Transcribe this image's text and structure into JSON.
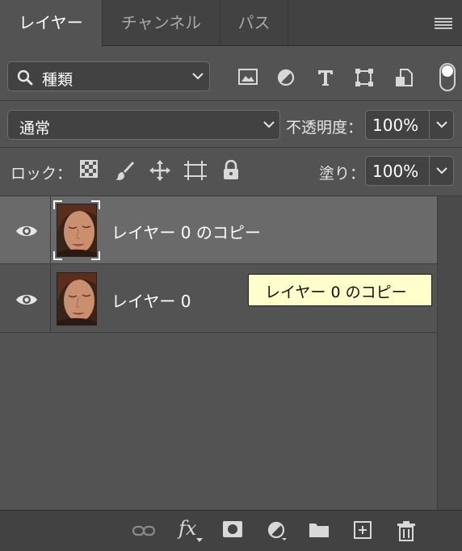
{
  "tabs": [
    {
      "label": "レイヤー",
      "active": true
    },
    {
      "label": "チャンネル",
      "active": false
    },
    {
      "label": "パス",
      "active": false
    }
  ],
  "filter": {
    "kind_label": "種類",
    "icons": [
      "image-filter-icon",
      "adjustment-filter-icon",
      "type-filter-icon",
      "shape-filter-icon",
      "smart-object-filter-icon"
    ],
    "toggle_on": true
  },
  "blend": {
    "mode": "通常",
    "opacity_label": "不透明度：",
    "opacity_value": "100%"
  },
  "lock": {
    "label": "ロック：",
    "icons": [
      "lock-transparent-pixels-icon",
      "lock-image-pixels-icon",
      "lock-position-icon",
      "lock-artboard-icon",
      "lock-all-icon"
    ],
    "fill_label": "塗り：",
    "fill_value": "100%"
  },
  "layers": [
    {
      "name": "レイヤー 0 のコピー",
      "visible": true,
      "selected": true
    },
    {
      "name": "レイヤー 0",
      "visible": true,
      "selected": false
    }
  ],
  "tooltip": {
    "text": "レイヤー 0 のコピー"
  },
  "bottom_bar": {
    "icons": [
      "link-layers-icon",
      "layer-style-fx-icon",
      "add-mask-icon",
      "new-adjustment-layer-icon",
      "new-group-folder-icon",
      "new-layer-icon",
      "delete-layer-icon"
    ],
    "fx_label": "fx"
  },
  "colors": {
    "panel_bg": "#535353",
    "tab_bar_bg": "#424242",
    "selected_row": "#6a6a6a",
    "tooltip_bg": "#ffffcc"
  }
}
